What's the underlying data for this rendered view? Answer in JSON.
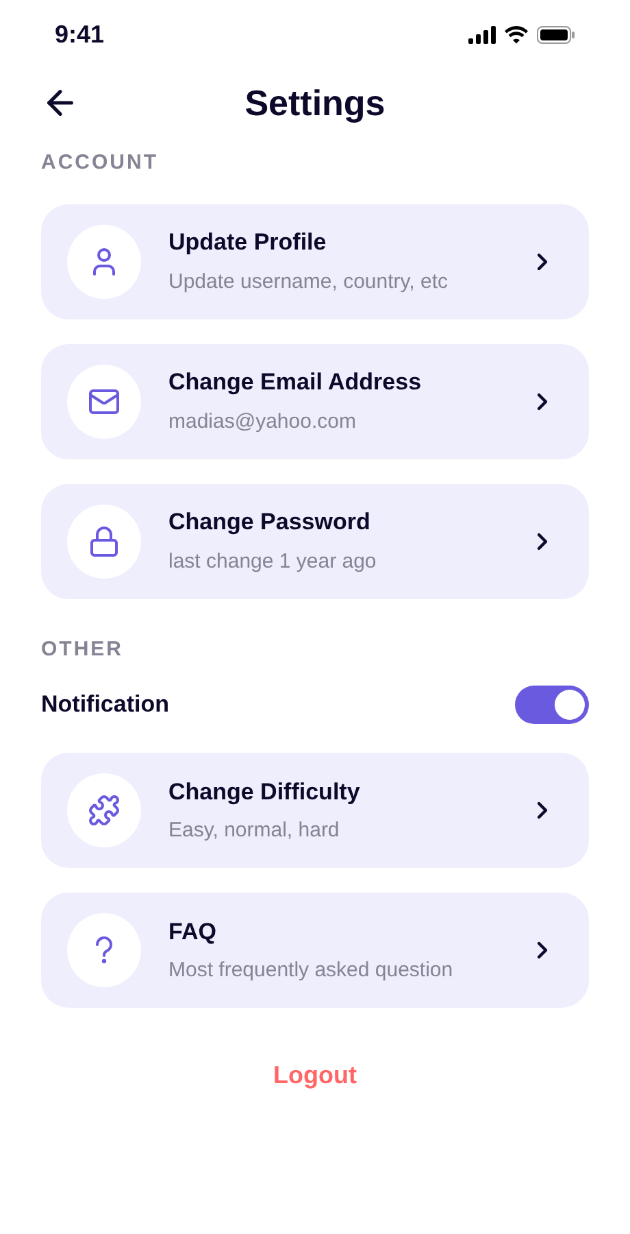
{
  "status_bar": {
    "time": "9:41"
  },
  "header": {
    "title": "Settings"
  },
  "sections": [
    {
      "title": "ACCOUNT",
      "items": [
        {
          "kind": "link",
          "title": "Update Profile",
          "subtitle": "Update username, country, etc"
        },
        {
          "kind": "link",
          "title": "Change Email Address",
          "subtitle": "madias@yahoo.com"
        },
        {
          "kind": "link",
          "title": "Change Password",
          "subtitle": "last change 1 year ago"
        }
      ]
    },
    {
      "title": "OTHER",
      "items": [
        {
          "kind": "toggle",
          "title": "Notification",
          "on": true
        },
        {
          "kind": "link",
          "title": "Change Difficulty",
          "subtitle": "Easy, normal, hard"
        },
        {
          "kind": "link",
          "title": "FAQ",
          "subtitle": "Most frequently asked question"
        }
      ]
    }
  ],
  "logout": {
    "label": "Logout"
  }
}
